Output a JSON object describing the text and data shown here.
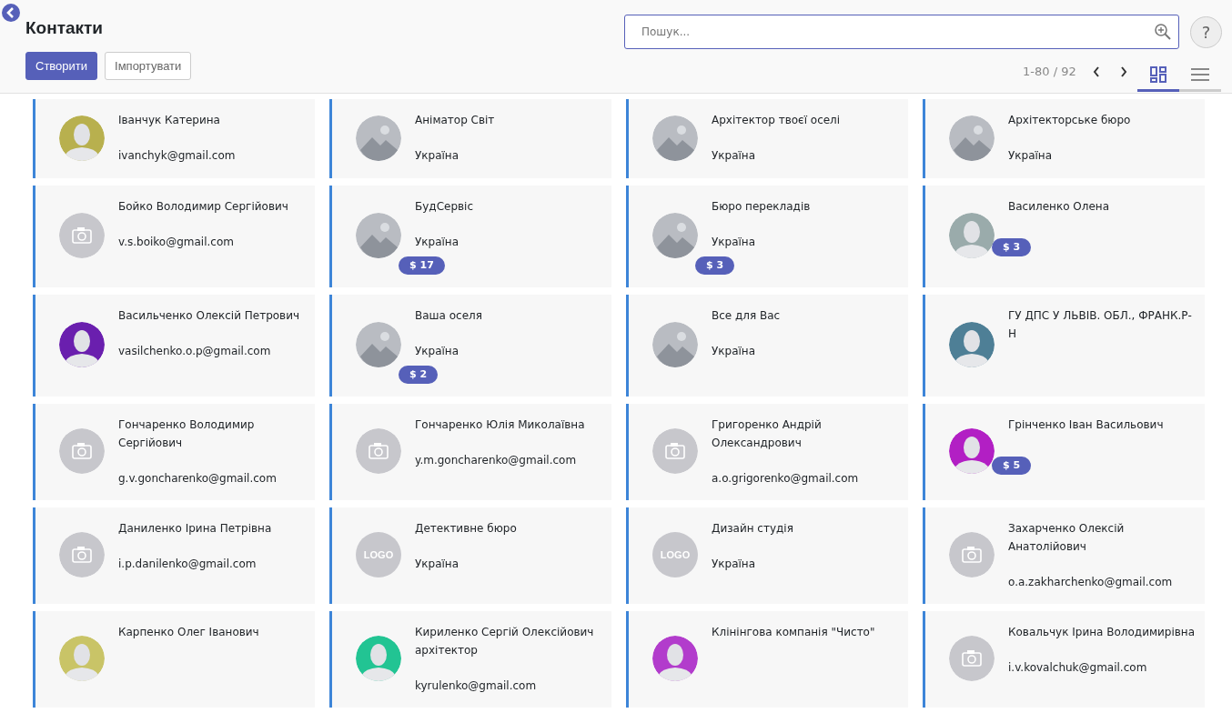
{
  "back_button": true,
  "title": "Контакти",
  "actions": [
    {
      "label": "Створити",
      "kind": "primary"
    },
    {
      "label": "Імпортувати",
      "kind": "secondary"
    }
  ],
  "search": {
    "placeholder": "Пошук..."
  },
  "help": "?",
  "pager": "1-80 / 92",
  "views": [
    {
      "kind": "kanban",
      "selected": true
    },
    {
      "kind": "list",
      "selected": false
    }
  ],
  "cards": [
    {
      "name": "Іванчук Катерина",
      "lines": [
        "ivanchyk@gmail.com"
      ],
      "avatar": {
        "kind": "person",
        "color": "#b8b04e"
      }
    },
    {
      "name": "Аніматор Світ",
      "lines": [
        "Україна"
      ],
      "avatar": {
        "kind": "photo"
      }
    },
    {
      "name": "Архітектор твоєї оселі",
      "lines": [
        "Україна"
      ],
      "avatar": {
        "kind": "photo"
      }
    },
    {
      "name": "Архітекторське бюро",
      "lines": [
        "Україна"
      ],
      "avatar": {
        "kind": "photo"
      }
    },
    {
      "name": "Бойко Володимир Сергійович",
      "lines": [
        "v.s.boiko@gmail.com"
      ],
      "avatar": {
        "kind": "camera"
      }
    },
    {
      "name": "БудСервіс",
      "lines": [
        "Україна"
      ],
      "badge": "$ 17",
      "avatar": {
        "kind": "photo"
      }
    },
    {
      "name": "Бюро перекладів",
      "lines": [
        "Україна"
      ],
      "badge": "$ 3",
      "avatar": {
        "kind": "photo"
      }
    },
    {
      "name": "Василенко Олена",
      "badge": "$ 3",
      "avatar": {
        "kind": "person",
        "color": "#9aabab"
      }
    },
    {
      "name": "Васильченко Олексій Петрович",
      "lines": [
        "vasilchenko.o.p@gmail.com"
      ],
      "avatar": {
        "kind": "person",
        "color": "#6a1fae"
      }
    },
    {
      "name": "Ваша оселя",
      "lines": [
        "Україна"
      ],
      "badge": "$ 2",
      "avatar": {
        "kind": "photo"
      }
    },
    {
      "name": "Все для Вас",
      "lines": [
        "Україна"
      ],
      "avatar": {
        "kind": "photo"
      }
    },
    {
      "name": "ГУ ДПС У ЛЬВІВ. ОБЛ., ФРАНК.Р-Н",
      "avatar": {
        "kind": "person",
        "color": "#4e7f96"
      }
    },
    {
      "name": "Гончаренко Володимир Сергійович",
      "lines": [
        "g.v.goncharenko@gmail.com"
      ],
      "avatar": {
        "kind": "camera"
      }
    },
    {
      "name": "Гончаренко Юлія Миколаївна",
      "lines": [
        "y.m.goncharenko@gmail.com"
      ],
      "avatar": {
        "kind": "camera"
      }
    },
    {
      "name": "Григоренко Андрій Олександрович",
      "lines": [
        "a.o.grigorenko@gmail.com"
      ],
      "avatar": {
        "kind": "camera"
      }
    },
    {
      "name": "Грінченко Іван Васильович",
      "badge": "$ 5",
      "avatar": {
        "kind": "person",
        "color": "#b21fc4"
      }
    },
    {
      "name": "Даниленко Ірина Петрівна",
      "lines": [
        "i.p.danilenko@gmail.com"
      ],
      "avatar": {
        "kind": "camera"
      }
    },
    {
      "name": "Детективне бюро",
      "lines": [
        "Україна"
      ],
      "avatar": {
        "kind": "logo",
        "text": "LOGO"
      }
    },
    {
      "name": "Дизайн студія",
      "lines": [
        "Україна"
      ],
      "avatar": {
        "kind": "logo",
        "text": "LOGO"
      }
    },
    {
      "name": "Захарченко Олексій Анатолійович",
      "lines": [
        "o.a.zakharchenko@gmail.com"
      ],
      "avatar": {
        "kind": "camera"
      }
    },
    {
      "name": "Карпенко Олег Іванович",
      "avatar": {
        "kind": "person",
        "color": "#c9c467"
      }
    },
    {
      "name": "Кириленко Сергій Олексійович",
      "job": "архітектор",
      "lines": [
        "kyrulenko@gmail.com"
      ],
      "avatar": {
        "kind": "person",
        "color": "#22c493"
      }
    },
    {
      "name": "Клінінгова компанія \"Чисто\"",
      "avatar": {
        "kind": "person",
        "color": "#b23ccc"
      }
    },
    {
      "name": "Ковальчук Ірина Володимирівна",
      "lines": [
        "i.v.kovalchuk@gmail.com"
      ],
      "avatar": {
        "kind": "camera"
      }
    }
  ]
}
